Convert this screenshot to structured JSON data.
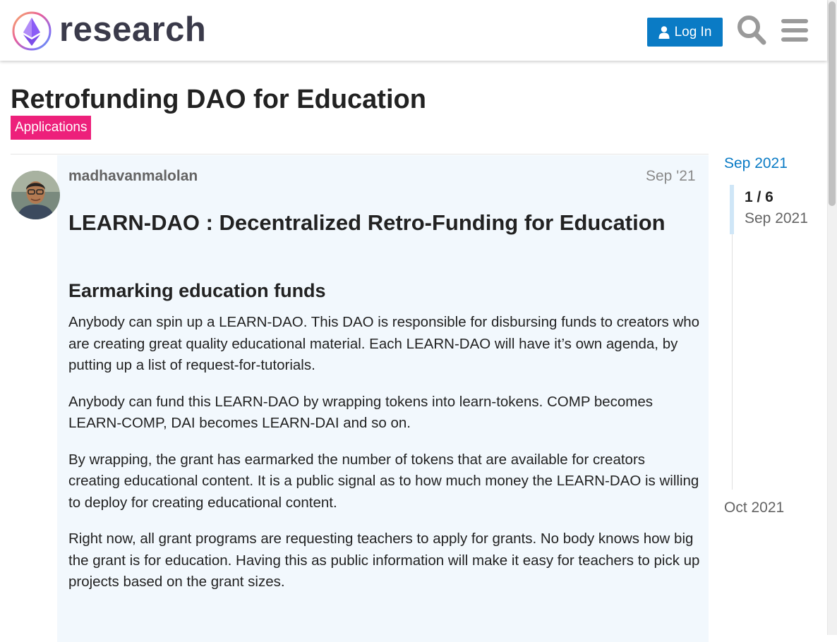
{
  "header": {
    "logo_text": "research",
    "login_label": "Log In",
    "icons": [
      "research-logo-icon",
      "user-icon",
      "search-icon",
      "hamburger-menu-icon"
    ]
  },
  "topic": {
    "title": "Retrofunding DAO for Education",
    "category": "Applications",
    "category_color": "#ed207b"
  },
  "post": {
    "username": "madhavanmalolan",
    "date": "Sep '21",
    "heading": "LEARN-DAO : Decentralized Retro-Funding for Education",
    "subheading": "Earmarking education funds",
    "paragraphs": [
      "Anybody can spin up a LEARN-DAO. This DAO is responsible for disbursing funds to creators who are creating great quality educational material. Each LEARN-DAO will have it’s own agenda, by putting up a list of request-for-tutorials.",
      "Anybody can fund this LEARN-DAO by wrapping tokens into learn-tokens. COMP becomes LEARN-COMP, DAI becomes LEARN-DAI and so on.",
      "By wrapping, the grant has earmarked the number of tokens that are available for creators creating educational content. It is a public signal as to how much money the LEARN-DAO is willing to deploy for creating educational content.",
      "Right now, all grant programs are requesting teachers to apply for grants. No body knows how big the grant is for education. Having this as public information will make it easy for teachers to pick up projects based on the grant sizes."
    ]
  },
  "timeline": {
    "start_date": "Sep 2021",
    "position": "1 / 6",
    "position_date": "Sep 2021",
    "end_date": "Oct 2021"
  },
  "colors": {
    "accent": "#0a7bc5",
    "post_background": "#f2f8fd"
  }
}
